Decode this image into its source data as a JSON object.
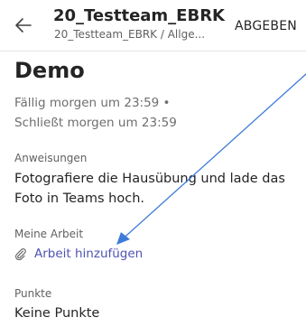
{
  "header": {
    "title": "20_Testteam_EBRK",
    "subtitle": "20_Testteam_EBRK / Allge...",
    "submit_label": "ABGEBEN"
  },
  "assignment": {
    "title": "Demo",
    "due": "Fällig morgen um 23:59 •",
    "closes": "Schließt morgen um 23:59",
    "instructions_label": "Anweisungen",
    "instructions_line1": "Fotografiere die Hausübung und lade das",
    "instructions_line2": "Foto in Teams hoch.",
    "my_work_label": "Meine Arbeit",
    "add_work_label": "Arbeit hinzufügen",
    "points_label": "Punkte",
    "points_value": "Keine Punkte"
  },
  "colors": {
    "accent": "#4f52b2",
    "annotation_arrow": "#3d7bd9"
  }
}
